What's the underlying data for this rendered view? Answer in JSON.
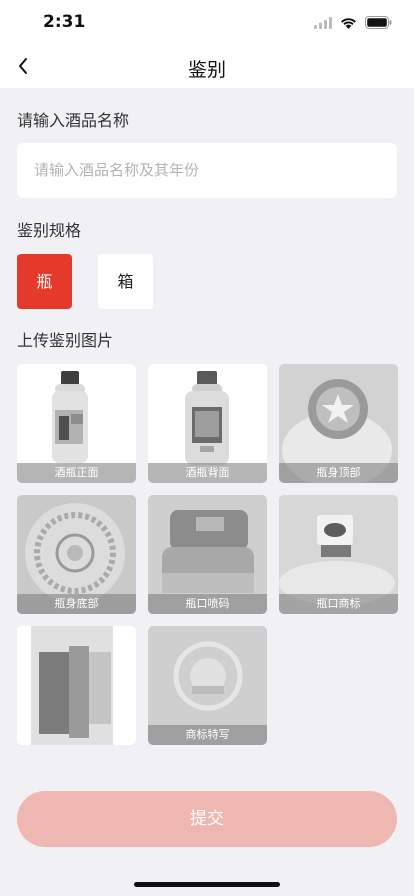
{
  "status_bar": {
    "time": "2:31"
  },
  "nav": {
    "title": "鉴别"
  },
  "form": {
    "name_label": "请输入酒品名称",
    "name_placeholder": "请输入酒品名称及其年份",
    "spec_label": "鉴别规格",
    "spec_options": [
      "瓶",
      "箱"
    ],
    "spec_selected": "瓶",
    "upload_label": "上传鉴别图片"
  },
  "photos": [
    {
      "caption": "酒瓶正面",
      "icon": "bottle-front-photo"
    },
    {
      "caption": "酒瓶背面",
      "icon": "bottle-back-photo"
    },
    {
      "caption": "瓶身顶部",
      "icon": "bottle-top-photo"
    },
    {
      "caption": "瓶身底部",
      "icon": "bottle-bottom-photo"
    },
    {
      "caption": "瓶口喷码",
      "icon": "bottle-neck-code-photo"
    },
    {
      "caption": "瓶口商标",
      "icon": "bottle-neck-label-photo"
    },
    {
      "caption": "",
      "icon": "bottle-side-photo"
    },
    {
      "caption": "商标特写",
      "icon": "logo-closeup-photo"
    }
  ],
  "submit": {
    "label": "提交"
  },
  "colors": {
    "accent": "#e53a2b",
    "submit_disabled": "#efb7b2",
    "background": "#f1f0f5"
  }
}
